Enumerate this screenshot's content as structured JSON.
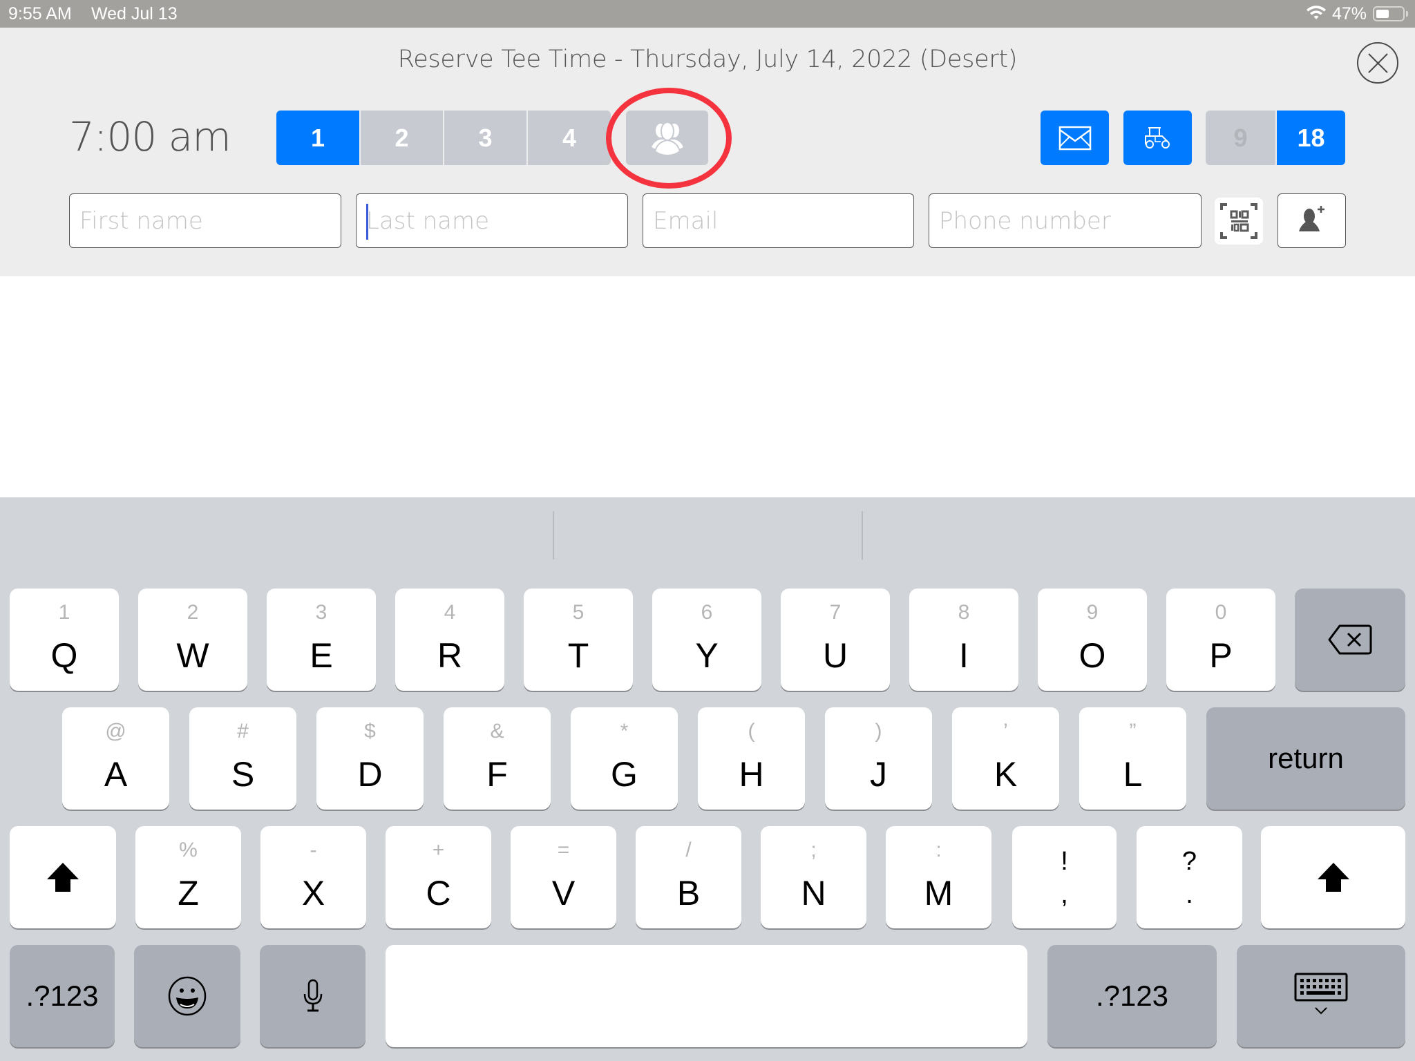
{
  "status_bar": {
    "time": "9:55 AM",
    "date": "Wed Jul 13",
    "wifi_icon": "wifi-icon",
    "battery_percent": "47%",
    "battery_level": 0.47
  },
  "dialog": {
    "title": "Reserve Tee Time - Thursday, July 14, 2022 (Desert)",
    "close_icon": "close-icon",
    "tee_time": "7:00 am",
    "player_count": {
      "options": [
        "1",
        "2",
        "3",
        "4"
      ],
      "selected": "1",
      "group_icon": "group-icon"
    },
    "actions": {
      "email_icon": "envelope-icon",
      "cart_icon": "golf-cart-icon"
    },
    "holes": {
      "options": [
        "9",
        "18"
      ],
      "selected": "18"
    },
    "fields": {
      "first_name": {
        "placeholder": "First name",
        "value": ""
      },
      "last_name": {
        "placeholder": "Last name",
        "value": ""
      },
      "email": {
        "placeholder": "Email",
        "value": ""
      },
      "phone": {
        "placeholder": "Phone number",
        "value": ""
      }
    },
    "qr_icon": "qr-code-scan-icon",
    "add_player_icon": "add-user-icon",
    "colors": {
      "accent": "#007aff",
      "inactive": "#c7cbd1",
      "highlight_ring": "#f5333f"
    }
  },
  "keyboard": {
    "row1": [
      {
        "alt": "1",
        "main": "Q"
      },
      {
        "alt": "2",
        "main": "W"
      },
      {
        "alt": "3",
        "main": "E"
      },
      {
        "alt": "4",
        "main": "R"
      },
      {
        "alt": "5",
        "main": "T"
      },
      {
        "alt": "6",
        "main": "Y"
      },
      {
        "alt": "7",
        "main": "U"
      },
      {
        "alt": "8",
        "main": "I"
      },
      {
        "alt": "9",
        "main": "O"
      },
      {
        "alt": "0",
        "main": "P"
      }
    ],
    "row2": [
      {
        "alt": "@",
        "main": "A"
      },
      {
        "alt": "#",
        "main": "S"
      },
      {
        "alt": "$",
        "main": "D"
      },
      {
        "alt": "&",
        "main": "F"
      },
      {
        "alt": "*",
        "main": "G"
      },
      {
        "alt": "(",
        "main": "H"
      },
      {
        "alt": ")",
        "main": "J"
      },
      {
        "alt": "’",
        "main": "K"
      },
      {
        "alt": "”",
        "main": "L"
      }
    ],
    "row3": [
      {
        "alt": "%",
        "main": "Z"
      },
      {
        "alt": "-",
        "main": "X"
      },
      {
        "alt": "+",
        "main": "C"
      },
      {
        "alt": "=",
        "main": "V"
      },
      {
        "alt": "/",
        "main": "B"
      },
      {
        "alt": ";",
        "main": "N"
      },
      {
        "alt": ":",
        "main": "M"
      }
    ],
    "row3_punct": [
      {
        "top": "!",
        "bottom": ","
      },
      {
        "top": "?",
        "bottom": "."
      }
    ],
    "return_label": "return",
    "numbers_label": ".?123",
    "backspace_icon": "backspace-icon",
    "shift_icon": "shift-icon",
    "emoji_icon": "emoji-icon",
    "mic_icon": "microphone-icon",
    "dismiss_icon": "keyboard-dismiss-icon",
    "space_label": ""
  }
}
